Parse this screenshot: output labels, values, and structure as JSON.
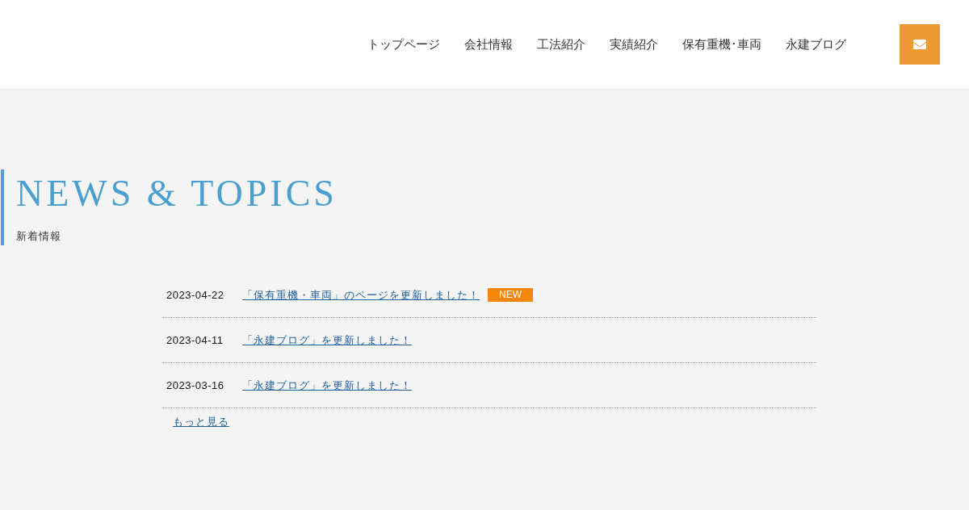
{
  "header": {
    "nav": [
      "トップページ",
      "会社情報",
      "工法紹介",
      "実績紹介",
      "保有重機･車両",
      "永建ブログ"
    ]
  },
  "section": {
    "title": "NEWS & TOPICS",
    "subtitle": "新着情報"
  },
  "news": [
    {
      "date": "2023-04-22",
      "title": "「保有重機・車両」のページを更新しました！",
      "badge": "NEW"
    },
    {
      "date": "2023-04-11",
      "title": "「永建ブログ」を更新しました！"
    },
    {
      "date": "2023-03-16",
      "title": "「永建ブログ」を更新しました！"
    }
  ],
  "more_link": "もっと見る"
}
